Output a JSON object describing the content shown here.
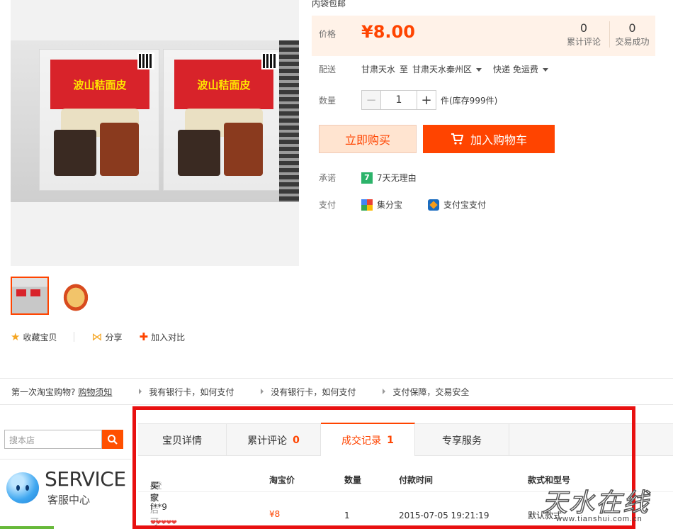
{
  "top_clip_text": "内袋包邮",
  "gallery": {
    "label_text": "波山秸面皮",
    "thumbnails": [
      "thumb-1",
      "thumb-2"
    ]
  },
  "actions": {
    "favorite": "收藏宝贝",
    "share": "分享",
    "compare": "加入对比"
  },
  "price": {
    "label": "价格",
    "value": "¥8.00",
    "reviews_count": "0",
    "reviews_label": "累计评论",
    "sales_count": "0",
    "sales_label": "交易成功"
  },
  "delivery": {
    "label": "配送",
    "from": "甘肃天水",
    "to_word": "至",
    "to": "甘肃天水秦州区",
    "method": "快递 免运费"
  },
  "quantity": {
    "label": "数量",
    "minus": "−",
    "value": "1",
    "plus": "+",
    "stock": "件(库存999件)"
  },
  "buttons": {
    "buy_now": "立即购买",
    "add_cart": "加入购物车"
  },
  "promise": {
    "label": "承诺",
    "badge": "7",
    "text": "7天无理由"
  },
  "payment": {
    "label": "支付",
    "method1": "集分宝",
    "method2": "支付宝支付"
  },
  "tips": {
    "first": "第一次淘宝购物?",
    "guide_link": "购物须知",
    "tip1": "我有银行卡，如何支付",
    "tip2": "没有银行卡，如何支付",
    "tip3": "支付保障，交易安全"
  },
  "sidebar": {
    "search_placeholder": "搜本店",
    "service_en": "SERVICE",
    "service_cn": "客服中心"
  },
  "tabs": [
    {
      "label": "宝贝详情",
      "count": ""
    },
    {
      "label": "累计评论",
      "count": "0"
    },
    {
      "label": "成交记录",
      "count": "1"
    },
    {
      "label": "专享服务",
      "count": ""
    }
  ],
  "records": {
    "headers": {
      "buyer": "买家",
      "buyer_note": "[登录后可见]",
      "price": "淘宝价",
      "qty": "数量",
      "time": "付款时间",
      "spec": "款式和型号"
    },
    "rows": [
      {
        "buyer": "f**9",
        "price": "¥8",
        "qty": "1",
        "time": "2015-07-05 19:21:19",
        "spec": "默认款式"
      }
    ]
  },
  "watermark": {
    "cn": "天水在线",
    "url": "www.tianshui.com.cn"
  },
  "colors": {
    "accent": "#ff4400",
    "frame": "#e81010"
  }
}
